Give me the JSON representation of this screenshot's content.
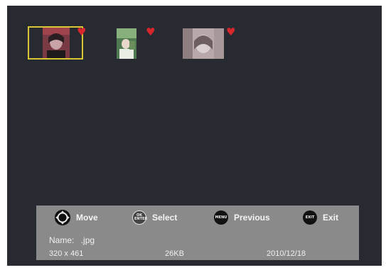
{
  "gallery": {
    "thumbnails": [
      {
        "selected": true,
        "favorite": true,
        "heart_icon": "heart-icon",
        "colors": [
          "#7a3a44",
          "#c9a4a6",
          "#2a1e23"
        ]
      },
      {
        "selected": false,
        "favorite": true,
        "heart_icon": "heart-icon",
        "colors": [
          "#4f7a51",
          "#e8eee4",
          "#88b07d"
        ]
      },
      {
        "selected": false,
        "favorite": true,
        "heart_icon": "heart-icon",
        "colors": [
          "#b9a8a9",
          "#8e7e80",
          "#d9cfd0"
        ]
      }
    ],
    "selection_color": "#d8c733",
    "heart_color": "#d8262d"
  },
  "controls": {
    "move": {
      "icon": "dpad-icon",
      "label": "Move"
    },
    "select": {
      "icon": "ok-enter-icon",
      "button_text": "OK ENTER",
      "label": "Select"
    },
    "previous": {
      "icon": "menu-icon",
      "button_text": "MENU",
      "label": "Previous"
    },
    "exit": {
      "icon": "exit-icon",
      "button_text": "EXIT",
      "label": "Exit"
    }
  },
  "file_info": {
    "name_label": "Name:",
    "name_value": ".jpg",
    "dimensions": "320 x 461",
    "size": "26KB",
    "date": "2010/12/18"
  }
}
